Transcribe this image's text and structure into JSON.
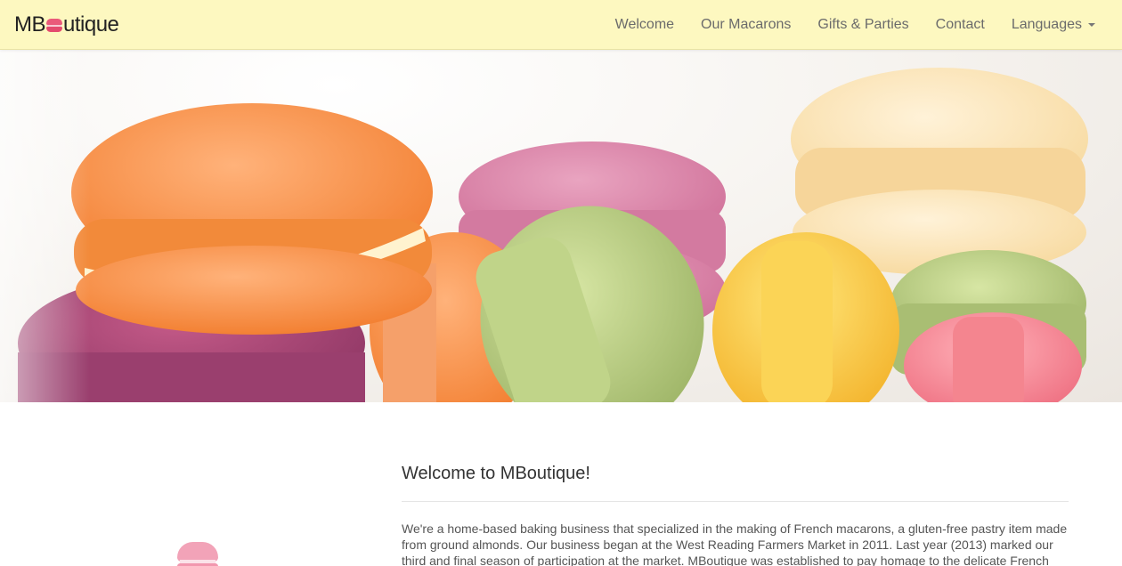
{
  "brand": {
    "prefix": "MB",
    "suffix": "utique"
  },
  "nav": {
    "items": [
      "Welcome",
      "Our Macarons",
      "Gifts & Parties",
      "Contact"
    ],
    "languages": "Languages"
  },
  "main": {
    "title": "Welcome to MBoutique!",
    "intro": "We're a home-based baking business that specialized in the making of French macarons, a gluten-free pastry item made from ground almonds. Our business began at the West Reading Farmers Market in 2011. Last year (2013) marked our third and final season of participation at the market. MBoutique was established to pay homage to the delicate French"
  },
  "colors": {
    "navbar_bg": "#fdf8c0",
    "brand_pink": "#ea5a7a",
    "side_macaron": "#f2a3b8"
  }
}
